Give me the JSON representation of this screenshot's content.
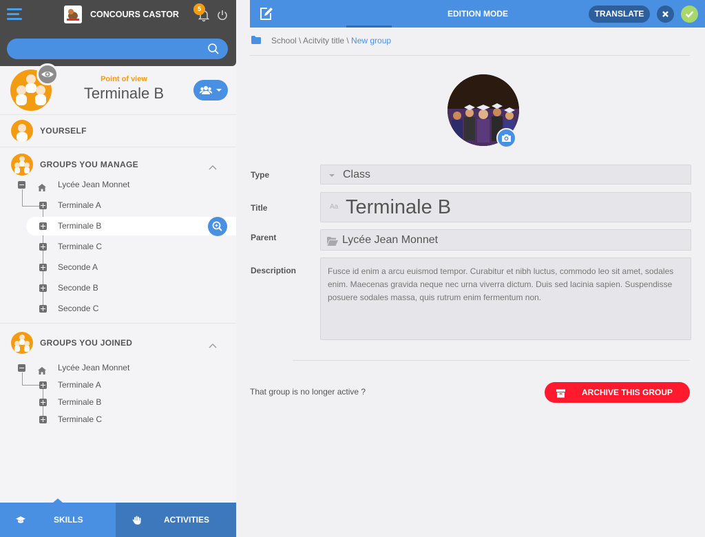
{
  "app": {
    "title": "CONCOURS CASTOR",
    "notifications_count": "5"
  },
  "search": {
    "placeholder": ""
  },
  "point_of_view": {
    "label": "Point of view",
    "name": "Terminale B"
  },
  "sidebar": {
    "yourself": "YOURSELF",
    "groups_manage": {
      "title": "GROUPS YOU MANAGE",
      "root": "Lycée Jean Monnet",
      "items": [
        "Terminale A",
        "Terminale B",
        "Terminale C",
        "Seconde A",
        "Seconde B",
        "Seconde C"
      ]
    },
    "groups_joined": {
      "title": "GROUPS YOU JOINED",
      "root": "Lycée Jean Monnet",
      "items": [
        "Terminale A",
        "Terminale B",
        "Terminale C"
      ]
    }
  },
  "bottom_tabs": {
    "skills": "SKILLS",
    "activities": "ACTIVITIES"
  },
  "main": {
    "mode_title": "EDITION MODE",
    "translate_label": "TRANSLATE",
    "breadcrumb": {
      "path": "School \\ Acitvity title \\ ",
      "current": "New group"
    },
    "form": {
      "type_label": "Type",
      "type_value": "Class",
      "title_label": "Title",
      "title_value": "Terminale B",
      "title_icon_text": "Aa",
      "parent_label": "Parent",
      "parent_value": "Lycée Jean Monnet",
      "description_label": "Description",
      "description_value": "Fusce id enim a arcu euismod tempor. Curabitur et nibh luctus, commodo leo sit amet, sodales enim. Maecenas gravida neque nec urna viverra dictum. Duis sed lacinia sapien. Suspendisse posuere sodales massa, quis rutrum enim fermentum non."
    },
    "archive": {
      "question": "That group is no longer active ?",
      "button_label": "ARCHIVE THIS GROUP"
    }
  },
  "colors": {
    "accent_blue": "#4a90e2",
    "dark_blue": "#2d5f9c",
    "orange": "#f39c12",
    "archive_red": "#ff1a2e",
    "confirm_green": "#a7d86a",
    "topbar_dark": "#4a4a4a"
  },
  "icons": [
    "menu-icon",
    "bell-icon",
    "power-icon",
    "search-icon",
    "eye-icon",
    "users-icon",
    "chevron-up-icon",
    "home-icon",
    "zoom-in-icon",
    "graduation-cap-icon",
    "hand-icon",
    "edit-icon",
    "close-icon",
    "check-icon",
    "folder-icon",
    "camera-icon",
    "folder-open-icon",
    "archive-icon"
  ]
}
